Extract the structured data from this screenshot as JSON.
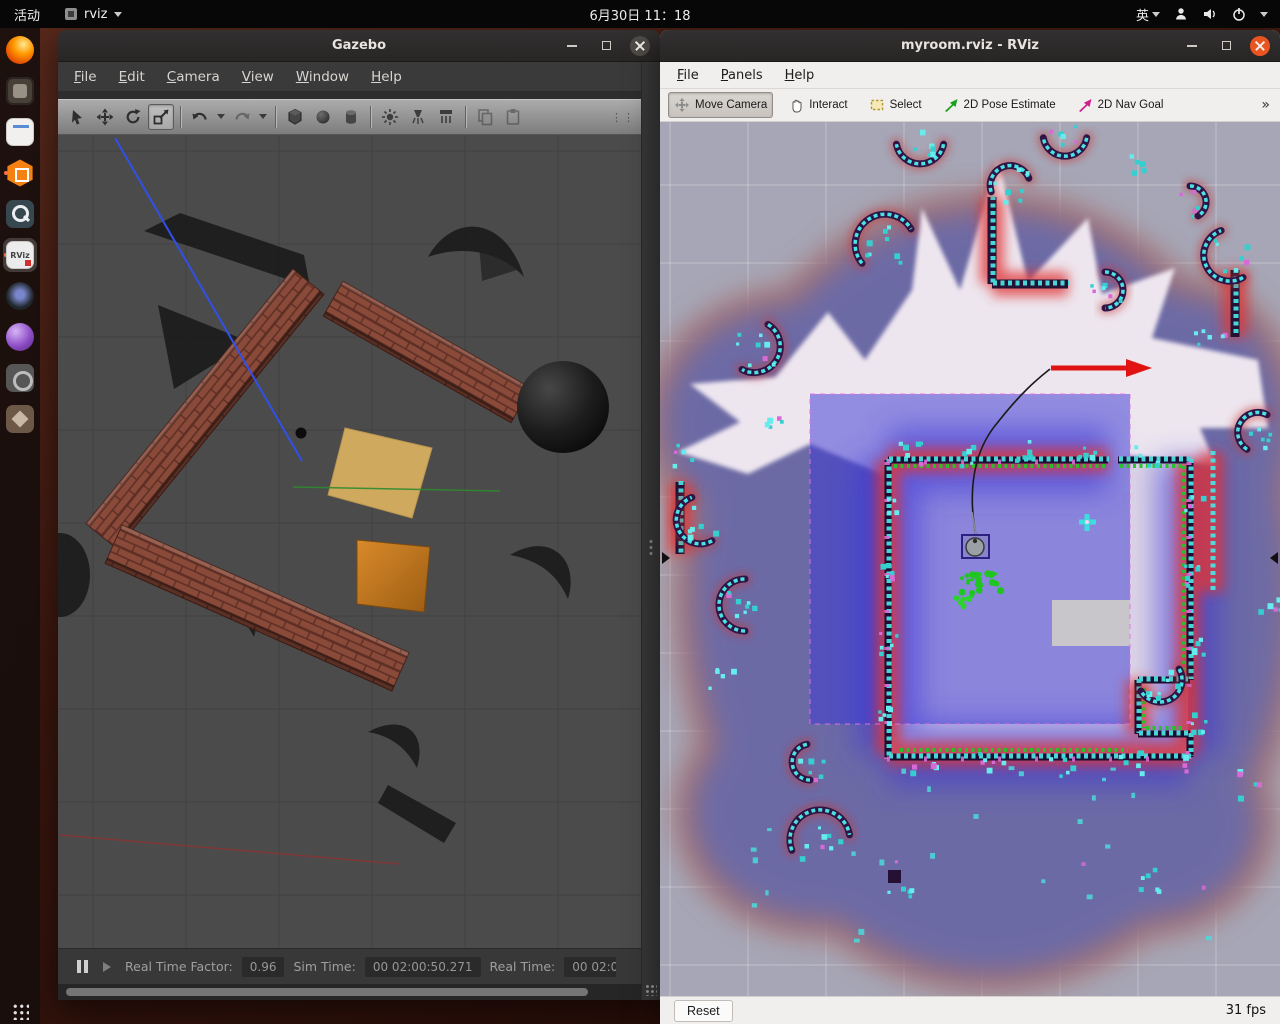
{
  "topbar": {
    "activities": "活动",
    "app_name": "rviz",
    "clock": "6月30日 11：18",
    "input_label": "英"
  },
  "dock": {
    "rviz_label": "RViz"
  },
  "gazebo": {
    "title": "Gazebo",
    "menus": [
      "File",
      "Edit",
      "Camera",
      "View",
      "Window",
      "Help"
    ],
    "status": {
      "rtf_label": "Real Time Factor:",
      "rtf_value": "0.96",
      "sim_label": "Sim Time:",
      "sim_value": "00 02:00:50.271",
      "real_label": "Real Time:",
      "real_value": "00 02:0"
    }
  },
  "rviz": {
    "title": "myroom.rviz - RViz",
    "menus": [
      "File",
      "Panels",
      "Help"
    ],
    "tools": [
      {
        "label": "Move Camera",
        "active": true
      },
      {
        "label": "Interact",
        "active": false
      },
      {
        "label": "Select",
        "active": false
      },
      {
        "label": "2D Pose Estimate",
        "active": false
      },
      {
        "label": "2D Nav Goal",
        "active": false
      }
    ],
    "overflow": "»",
    "reset_label": "Reset",
    "fps": "31 fps"
  },
  "colors": {
    "ubuntu_orange": "#e95420",
    "costmap_blue": "#4040d2",
    "inflation_red": "#e03434",
    "obstacle_cyan": "#4ae2e2",
    "laser_green": "#22c822",
    "nav_goal_red": "#e01212",
    "nav_goal_tool_magenta": "#d02090",
    "pose_estimate_green": "#19a119"
  }
}
